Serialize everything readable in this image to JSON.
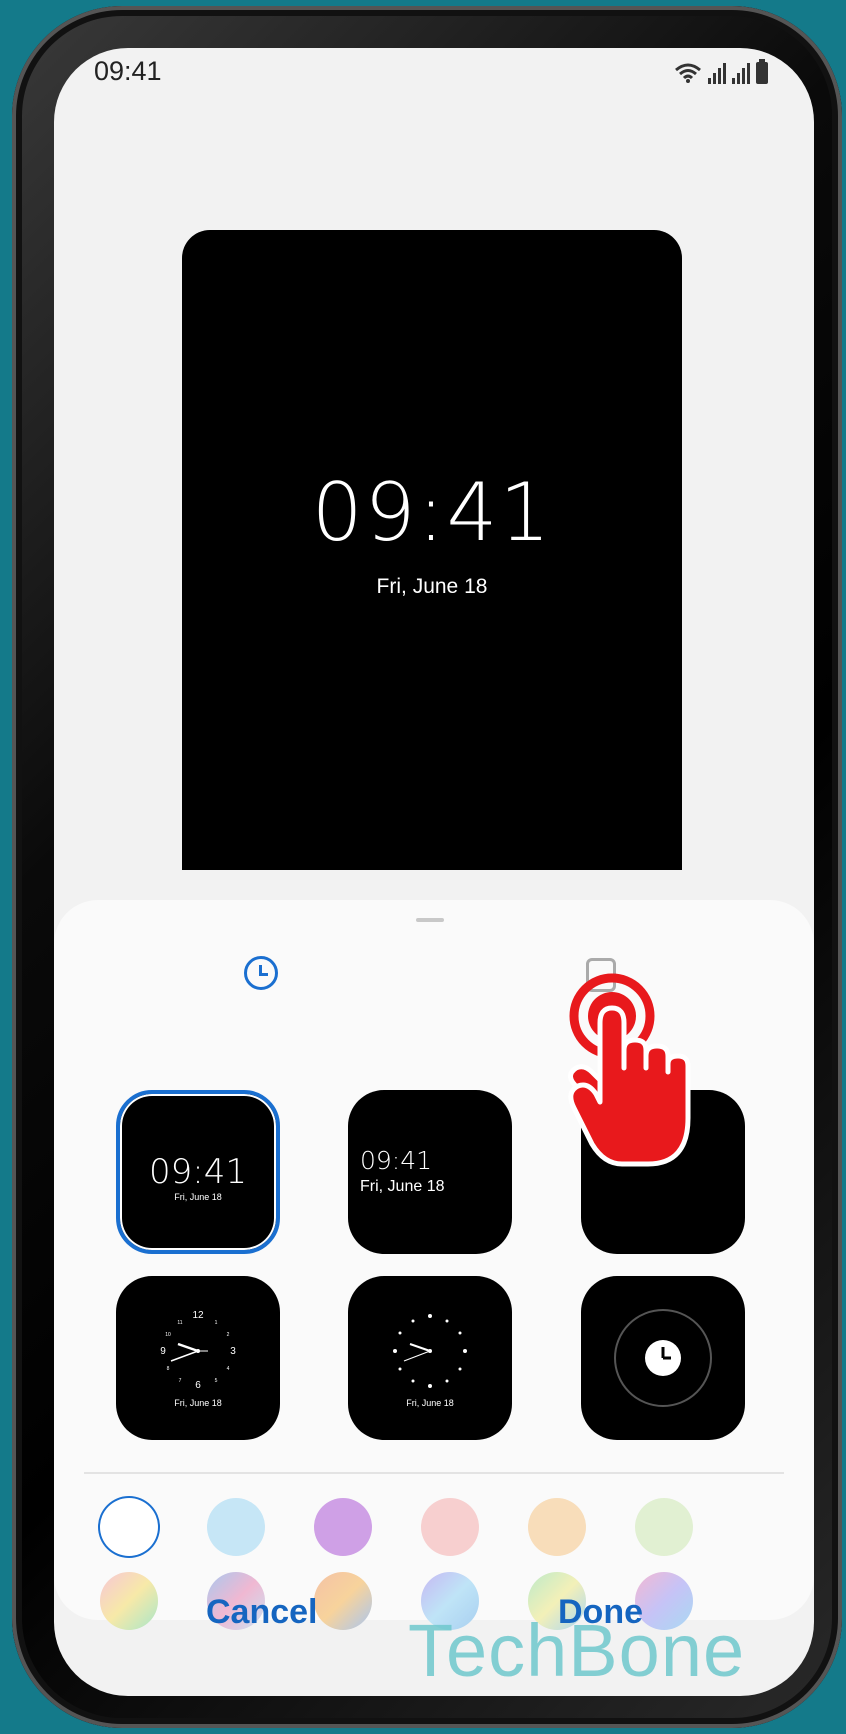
{
  "status_bar": {
    "time": "09:41"
  },
  "preview": {
    "time": "09:41",
    "date": "Fri, June 18"
  },
  "tabs": [
    {
      "icon": "clock-icon",
      "selected": true
    },
    {
      "icon": "image-icon",
      "selected": false
    }
  ],
  "clock_styles": [
    {
      "kind": "digital-center",
      "time": "09:41",
      "date": "Fri, June 18",
      "selected": true
    },
    {
      "kind": "digital-left",
      "time": "09:41",
      "date": "Fri, June 18",
      "selected": false
    },
    {
      "kind": "covered",
      "selected": false
    },
    {
      "kind": "analog-numbers",
      "date": "Fri, June 18",
      "numerals": [
        "12",
        "3",
        "6",
        "9",
        "1",
        "2",
        "4",
        "5",
        "7",
        "8",
        "10",
        "11"
      ],
      "selected": false
    },
    {
      "kind": "analog-dots",
      "date": "Fri, June 18",
      "selected": false
    },
    {
      "kind": "clock-icon-style",
      "selected": false
    }
  ],
  "colors": [
    {
      "name": "white",
      "value": "#ffffff",
      "selected": true
    },
    {
      "name": "light-blue",
      "value": "#c6e6f6"
    },
    {
      "name": "purple",
      "value": "#cfa0e6"
    },
    {
      "name": "pink",
      "value": "#f7cfcf"
    },
    {
      "name": "peach",
      "value": "#f8ddba"
    },
    {
      "name": "light-green",
      "value": "#e1f0d2"
    },
    {
      "name": "gradient-1",
      "value": "linear-gradient(135deg,#f7c6d6,#f7e9a8,#a8e6c9)"
    },
    {
      "name": "gradient-2",
      "value": "linear-gradient(135deg,#a9c8ee,#f0b8d2,#c8e3f3)"
    },
    {
      "name": "gradient-3",
      "value": "linear-gradient(135deg,#f4c2a6,#f7d39c,#a9c6f0)"
    },
    {
      "name": "gradient-4",
      "value": "linear-gradient(135deg,#c6b8f3,#bfe4f7,#a8cff0)"
    },
    {
      "name": "gradient-5",
      "value": "linear-gradient(135deg,#bdeac9,#f3f0b8,#a9d6f3)"
    },
    {
      "name": "gradient-6",
      "value": "linear-gradient(135deg,#f3b8d3,#c6c3f6,#a9d9f3)"
    }
  ],
  "buttons": {
    "cancel": "Cancel",
    "done": "Done"
  },
  "watermark": "TechBone",
  "accent_color": "#1a6fd0"
}
